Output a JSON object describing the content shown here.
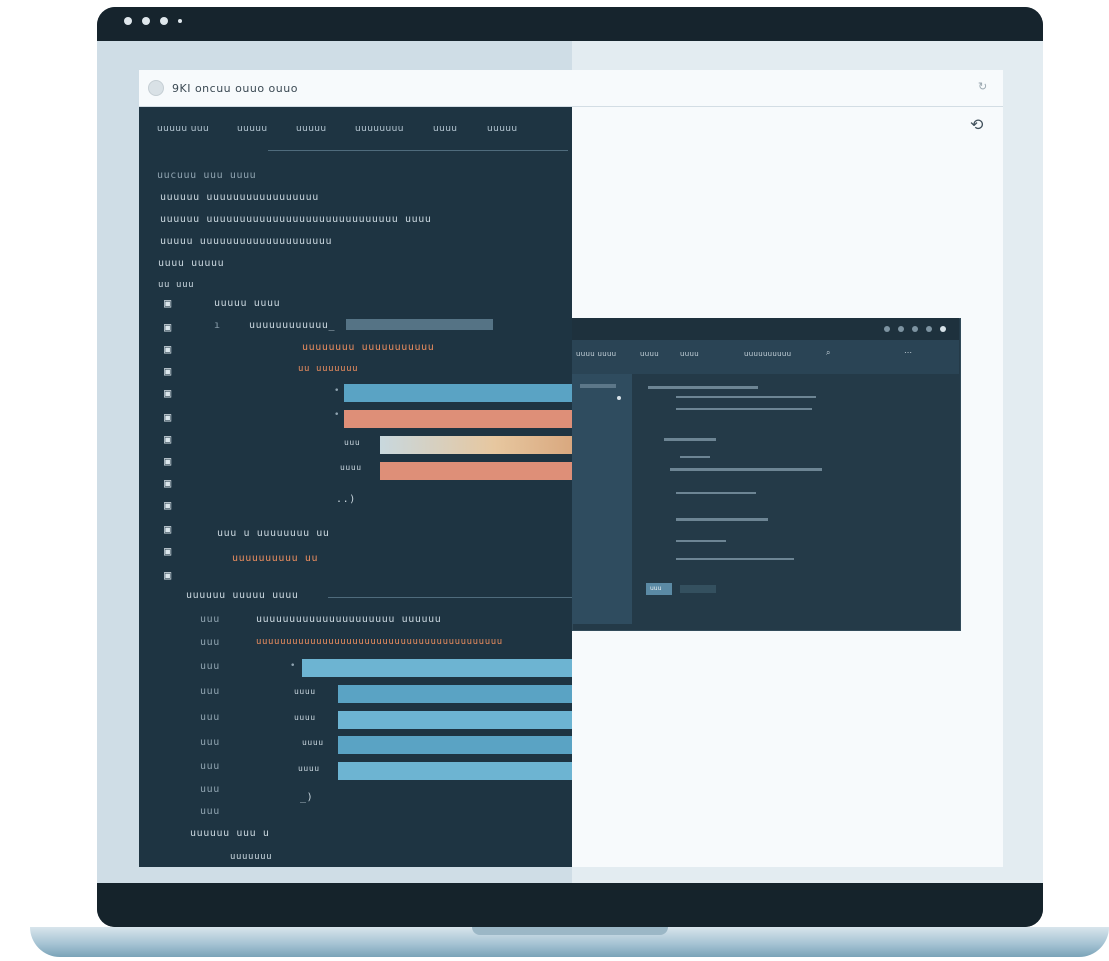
{
  "browser": {
    "address": "9KI  oncuu   ouuo ouuo",
    "action": "↻"
  },
  "tabs": [
    "uuuuu uuu",
    "uuuuu",
    "uuuuu",
    "uuuuuuuu",
    "uuuu",
    "uuuuu"
  ],
  "code_lines": [
    "uucuuu  uuu uuuu",
    "uuuuuu    uuuuuuuuuuuuuuuuu",
    "uuuuuu    uuuuuuuuuuuuuuuuuuuuuuuuuuuuu uuuu",
    "uuuuu     uuuuuuuuuuuuuuuuuuuu",
    "uuuu  uuuuu",
    "uu uuu",
    "uuuuu uuuu",
    "uuuuuuuuuuuu_",
    "uuuuuuuu uuuuuuuuuuu",
    "uu uuuuuuu",
    "uuu",
    "uuuu",
    "uu uuu",
    "uuu u uuuuuuuu uu",
    "uuuuuuuuuu uu",
    "uuuuuu uuuuu uuuu",
    "uuuuuuuuuuuuuuuuuuuuu uuuuuu",
    "uuuuuuuuuuuuuuuuuuuuuuuuuuuuuuuuuuuuuuuuu",
    "uuuu",
    "uuuu",
    "uuuu",
    "uuuu",
    "uuuuuu uuu u",
    "uuuuuuu"
  ],
  "line_numbers": [
    "uuu",
    "uuu",
    "uuu",
    "uuu",
    "uuu",
    "uuu",
    "uuu",
    "uuu",
    "uuu"
  ],
  "float_window": {
    "toolbar": [
      "uuuu uuuu",
      "uuuu",
      "uuuu",
      "uuuuuuuuuu"
    ],
    "button": "uuu"
  },
  "colors": {
    "code_bg": "#1e3442",
    "accent_blue": "#5aa3c4",
    "accent_salmon": "#de8f78",
    "page_bg": "#f7fafc"
  }
}
